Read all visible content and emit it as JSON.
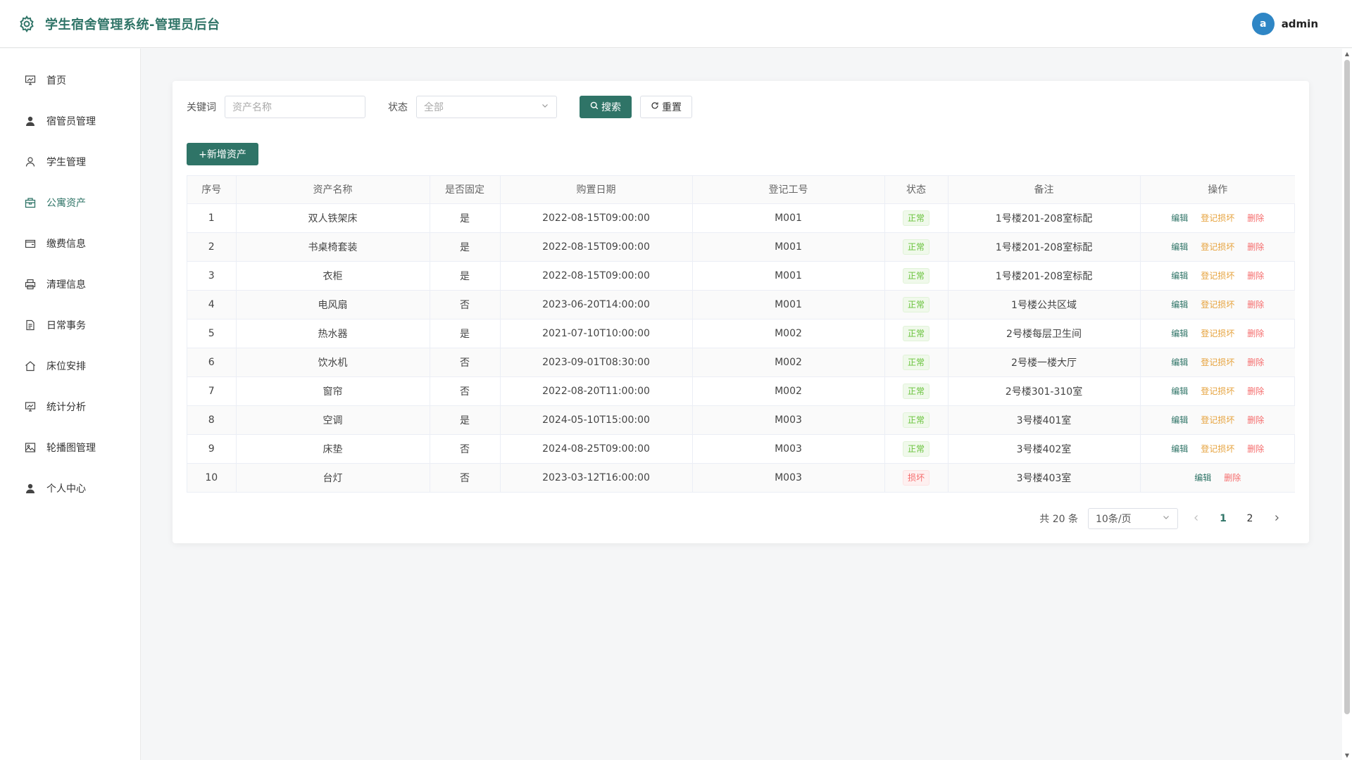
{
  "header": {
    "title": "学生宿舍管理系统-管理员后台",
    "user": {
      "avatar_letter": "a",
      "name": "admin"
    }
  },
  "sidebar": {
    "items": [
      {
        "label": "首页",
        "icon": "chart-icon"
      },
      {
        "label": "宿管员管理",
        "icon": "user-icon"
      },
      {
        "label": "学生管理",
        "icon": "user-outline-icon"
      },
      {
        "label": "公寓资产",
        "icon": "box-icon",
        "active": true
      },
      {
        "label": "缴费信息",
        "icon": "wallet-icon"
      },
      {
        "label": "清理信息",
        "icon": "printer-icon"
      },
      {
        "label": "日常事务",
        "icon": "document-icon"
      },
      {
        "label": "床位安排",
        "icon": "home-icon"
      },
      {
        "label": "统计分析",
        "icon": "chart-icon"
      },
      {
        "label": "轮播图管理",
        "icon": "image-icon"
      },
      {
        "label": "个人中心",
        "icon": "user-icon"
      }
    ]
  },
  "filters": {
    "keyword_label": "关键词",
    "keyword_placeholder": "资产名称",
    "status_label": "状态",
    "status_value": "全部",
    "search_label": "搜索",
    "reset_label": "重置"
  },
  "add_button_label": "+新增资产",
  "table": {
    "columns": [
      "序号",
      "资产名称",
      "是否固定",
      "购置日期",
      "登记工号",
      "状态",
      "备注",
      "操作"
    ],
    "rows": [
      {
        "no": "1",
        "name": "双人铁架床",
        "fixed": "是",
        "date": "2022-08-15T09:00:00",
        "staff": "M001",
        "status": "正常",
        "remark": "1号楼201-208室标配"
      },
      {
        "no": "2",
        "name": "书桌椅套装",
        "fixed": "是",
        "date": "2022-08-15T09:00:00",
        "staff": "M001",
        "status": "正常",
        "remark": "1号楼201-208室标配"
      },
      {
        "no": "3",
        "name": "衣柜",
        "fixed": "是",
        "date": "2022-08-15T09:00:00",
        "staff": "M001",
        "status": "正常",
        "remark": "1号楼201-208室标配"
      },
      {
        "no": "4",
        "name": "电风扇",
        "fixed": "否",
        "date": "2023-06-20T14:00:00",
        "staff": "M001",
        "status": "正常",
        "remark": "1号楼公共区域"
      },
      {
        "no": "5",
        "name": "热水器",
        "fixed": "是",
        "date": "2021-07-10T10:00:00",
        "staff": "M002",
        "status": "正常",
        "remark": "2号楼每层卫生间"
      },
      {
        "no": "6",
        "name": "饮水机",
        "fixed": "否",
        "date": "2023-09-01T08:30:00",
        "staff": "M002",
        "status": "正常",
        "remark": "2号楼一楼大厅"
      },
      {
        "no": "7",
        "name": "窗帘",
        "fixed": "否",
        "date": "2022-08-20T11:00:00",
        "staff": "M002",
        "status": "正常",
        "remark": "2号楼301-310室"
      },
      {
        "no": "8",
        "name": "空调",
        "fixed": "是",
        "date": "2024-05-10T15:00:00",
        "staff": "M003",
        "status": "正常",
        "remark": "3号楼401室"
      },
      {
        "no": "9",
        "name": "床垫",
        "fixed": "否",
        "date": "2024-08-25T09:00:00",
        "staff": "M003",
        "status": "正常",
        "remark": "3号楼402室"
      },
      {
        "no": "10",
        "name": "台灯",
        "fixed": "否",
        "date": "2023-03-12T16:00:00",
        "staff": "M003",
        "status": "损坏",
        "remark": "3号楼403室"
      }
    ],
    "ops": {
      "edit": "编辑",
      "damage": "登记损坏",
      "delete": "删除"
    }
  },
  "pagination": {
    "total_text": "共 20 条",
    "page_size": "10条/页",
    "pages": [
      "1",
      "2"
    ],
    "current": "1"
  },
  "colors": {
    "accent": "#2f7467",
    "ok": "#67c23a",
    "danger": "#f56c6c",
    "warning": "#e6a23c",
    "avatar": "#2f86c5"
  }
}
